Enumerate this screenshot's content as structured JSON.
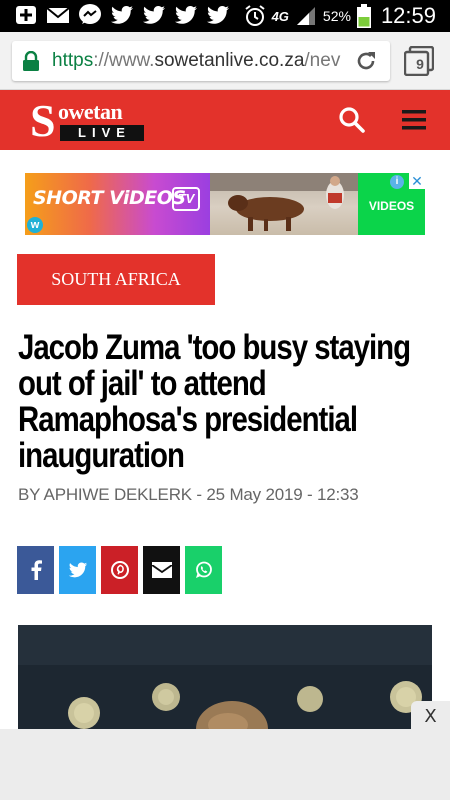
{
  "status_bar": {
    "battery": "52%",
    "time": "12:59",
    "network": "4G"
  },
  "browser": {
    "url_scheme": "https",
    "url_sep": "://www.",
    "url_host": "sowetanlive.co.za",
    "url_rest": "/nev",
    "tab_count": "9"
  },
  "site": {
    "logo_s": "S",
    "logo_owetan": "owetan",
    "logo_live": "LIVE"
  },
  "ad": {
    "title": "SHORT ViDEOS",
    "tv": "TV",
    "w": "w",
    "cta": "VIDEOS",
    "info": "i",
    "close": "✕"
  },
  "article": {
    "category": "SOUTH AFRICA",
    "headline": "Jacob Zuma 'too busy staying out of jail' to attend Ramaphosa's presidential inauguration",
    "byline": "BY APHIWE DEKLERK - 25 May 2019 - 12:33"
  },
  "close_label": "X",
  "colors": {
    "brand_red": "#e3322b",
    "facebook": "#3b5998",
    "twitter": "#2ba4f0",
    "pinterest": "#cb2027",
    "email": "#111111",
    "whatsapp": "#19d06a"
  }
}
